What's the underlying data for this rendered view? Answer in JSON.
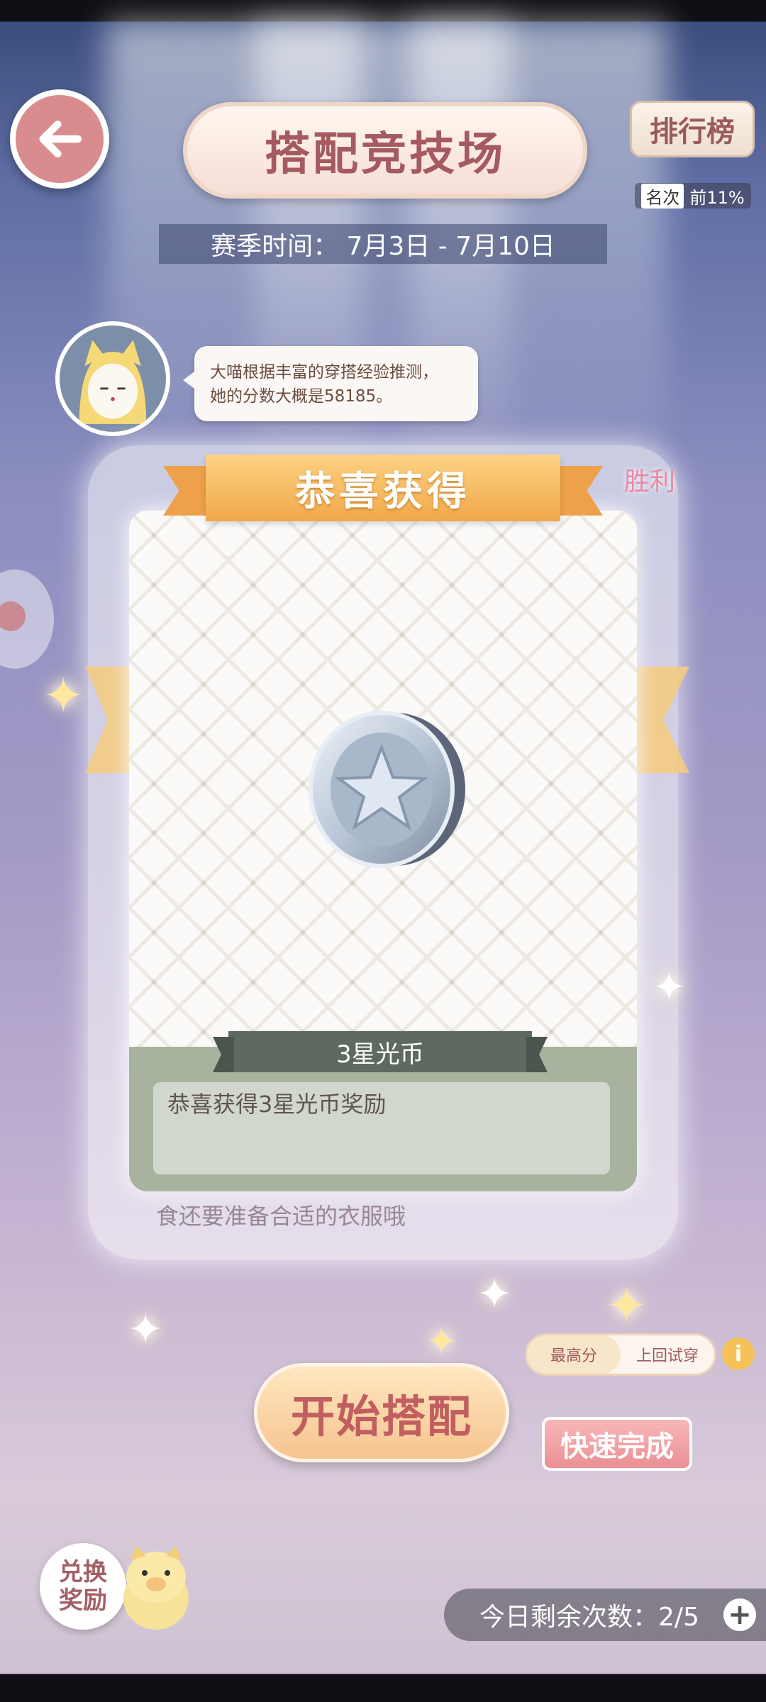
{
  "header": {
    "back_icon": "arrow-left-icon",
    "title": "搭配竞技场",
    "rank_button": "排行榜",
    "rank_label": "名次",
    "rank_value": "前11%",
    "season_text": "赛季时间： 7月3日 - 7月10日"
  },
  "hint": {
    "line1": "大喵根据丰富的穿搭经验推测，",
    "line2": "她的分数大概是58185。"
  },
  "background_card": {
    "win_text": "胜利",
    "hidden_text": "食还要准备合适的衣服哦"
  },
  "reward": {
    "banner": "恭喜获得",
    "item_name": "3星光币",
    "description": "恭喜获得3星光币奖励",
    "icon": "star-coin-icon"
  },
  "controls": {
    "toggle_options": [
      "最高分",
      "上回试穿"
    ],
    "toggle_active": "最高分",
    "info_icon": "info-icon",
    "start_button": "开始搭配",
    "quick_button": "快速完成",
    "exchange_line1": "兑换",
    "exchange_line2": "奖励",
    "remain_text": "今日剩余次数：2/5",
    "plus_icon": "plus-icon"
  },
  "colors": {
    "accent_pink": "#c05e60",
    "ribbon_orange": "#f1a84a",
    "banner_green": "#5e6960"
  }
}
